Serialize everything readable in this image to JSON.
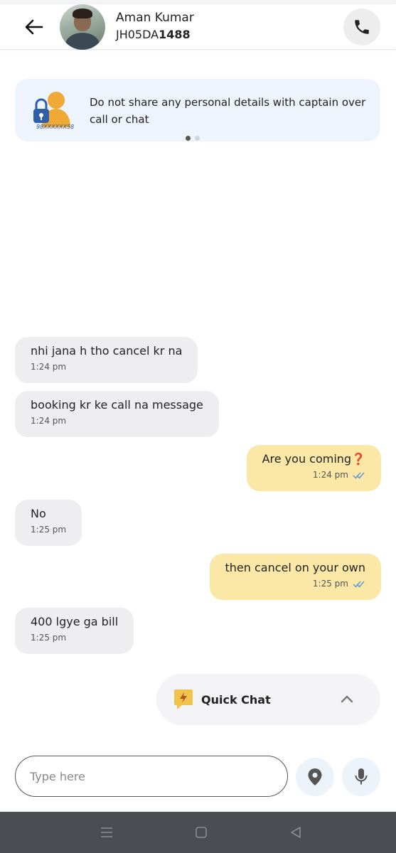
{
  "header": {
    "driver_name": "Aman Kumar",
    "plate_prefix": "JH05DA",
    "plate_number": "1488"
  },
  "banner": {
    "text": "Do not share any personal details with captain over call or chat",
    "masked_number": "98XXXXXX58"
  },
  "messages": [
    {
      "direction": "in",
      "text": "nhi jana h tho cancel kr na",
      "time": "1:24 pm"
    },
    {
      "direction": "in",
      "text": "booking kr ke call na message",
      "time": "1:24 pm"
    },
    {
      "direction": "out",
      "text": "Are you coming❓",
      "time": "1:24 pm",
      "status": "read"
    },
    {
      "direction": "in",
      "text": "No",
      "time": "1:25 pm"
    },
    {
      "direction": "out",
      "text": "then cancel on your own",
      "time": "1:25 pm",
      "status": "read"
    },
    {
      "direction": "in",
      "text": "400 lgye ga bill",
      "time": "1:25 pm"
    }
  ],
  "quick_chat": {
    "label": "Quick Chat"
  },
  "composer": {
    "placeholder": "Type here"
  },
  "colors": {
    "incoming_bubble": "#eeeef0",
    "outgoing_bubble": "#fbe7a6",
    "read_tick": "#5b9bd5",
    "banner_bg": "#eef4fb",
    "nav_bar": "#4b4d52"
  }
}
